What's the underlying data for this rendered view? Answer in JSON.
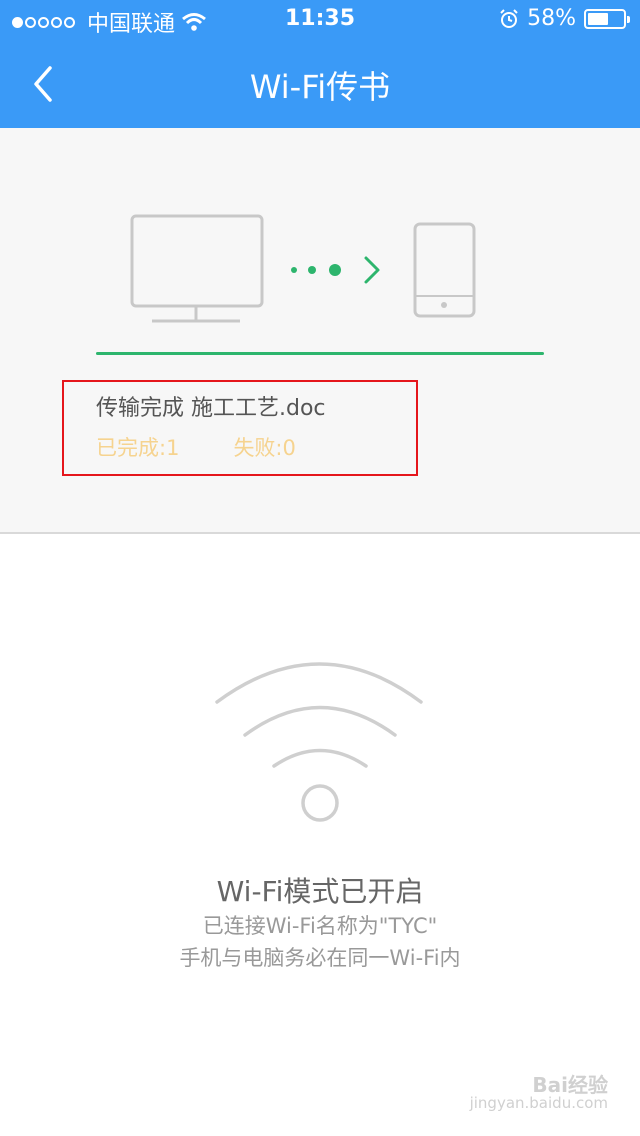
{
  "status_bar": {
    "carrier": "中国联通",
    "time": "11:35",
    "battery": "58%",
    "battery_level": 0.58
  },
  "nav": {
    "title": "Wi-Fi传书"
  },
  "transfer": {
    "status_text": "传输完成 施工工艺.doc",
    "completed_label": "已完成:1",
    "failed_label": "失败:0",
    "progress": 1.0
  },
  "wifi": {
    "title": "Wi-Fi模式已开启",
    "line1": "已连接Wi-Fi名称为\"TYC\"",
    "line2": "手机与电脑务必在同一Wi-Fi内"
  },
  "watermark": {
    "brand": "Bai经验",
    "url": "jingyan.baidu.com"
  },
  "colors": {
    "nav_bg": "#3a9af7",
    "progress": "#2db56d",
    "count_text": "#f6d38f",
    "highlight": "#e5161c"
  }
}
